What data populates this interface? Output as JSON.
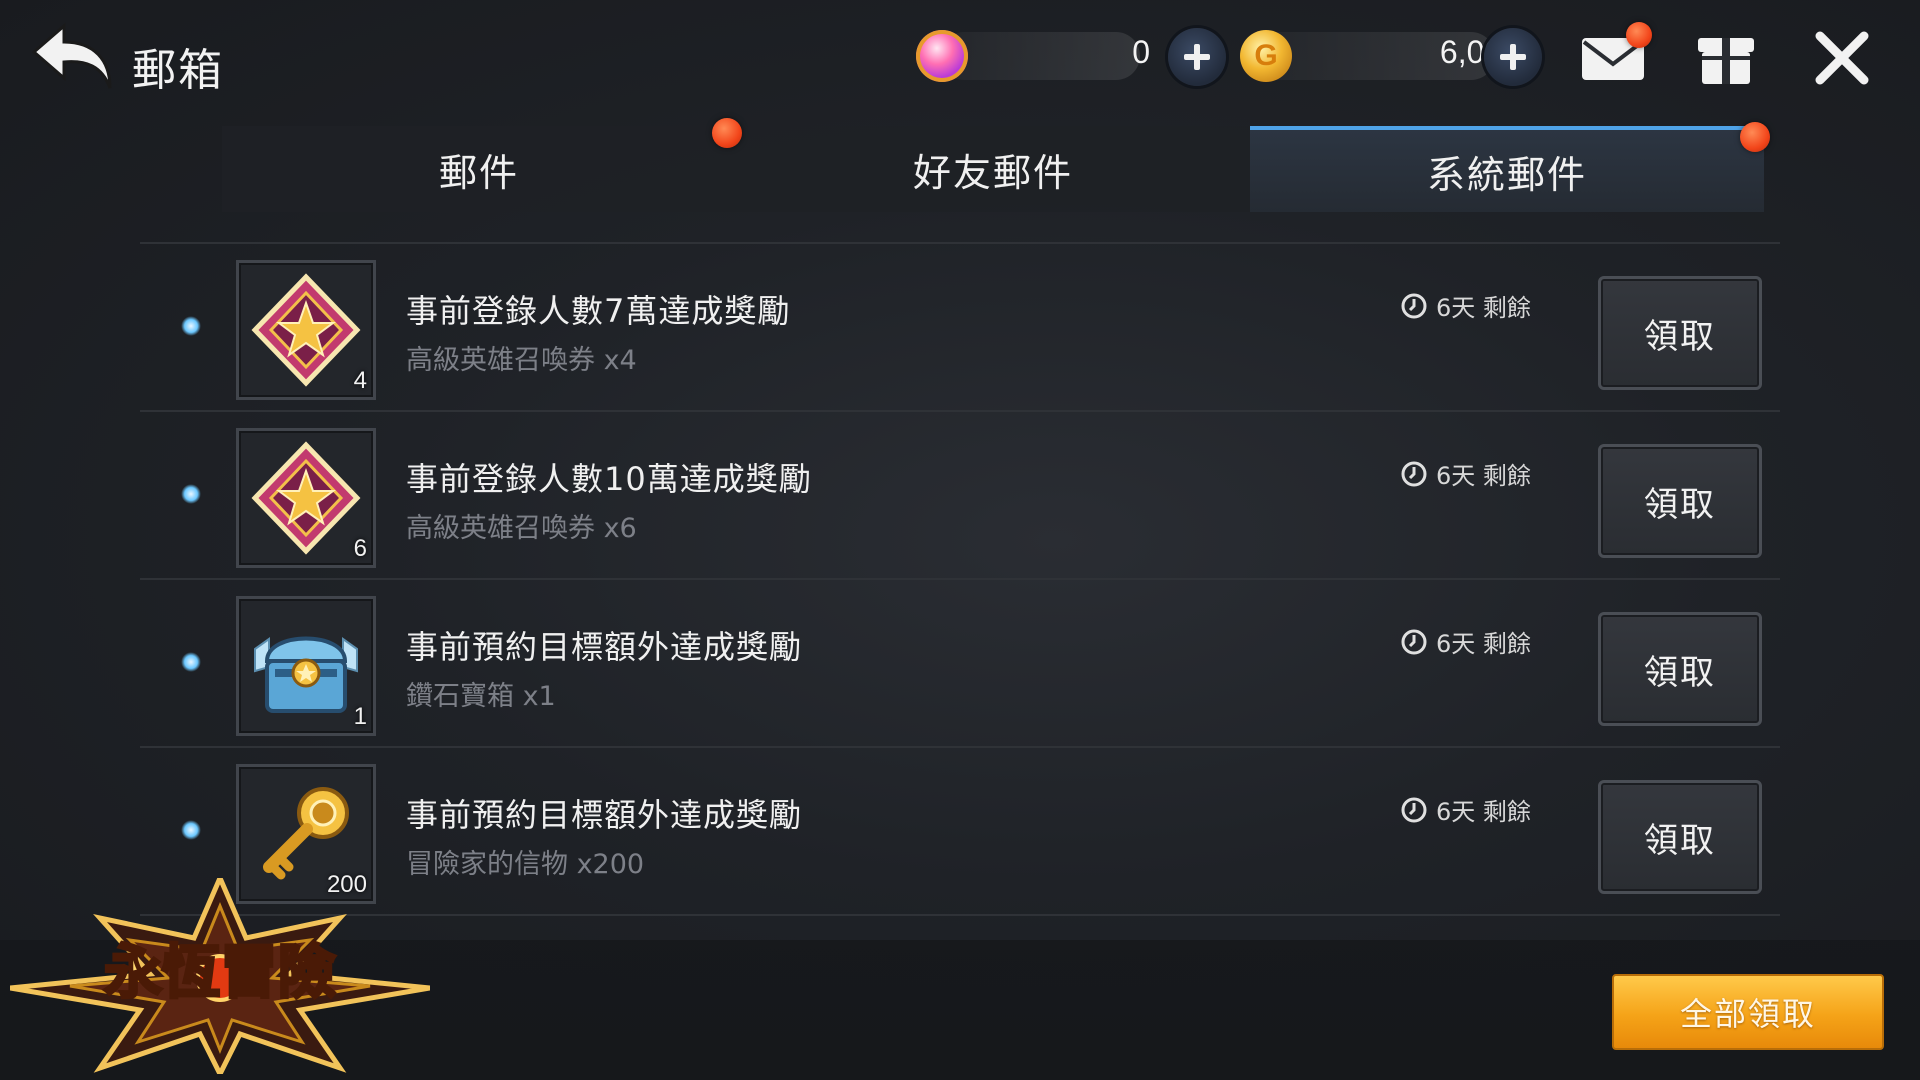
{
  "header": {
    "title": "郵箱",
    "gem_value": "0",
    "gold_value": "6,000"
  },
  "tabs": [
    {
      "label": "郵件",
      "active": false,
      "has_notice": true
    },
    {
      "label": "好友郵件",
      "active": false,
      "has_notice": false
    },
    {
      "label": "系統郵件",
      "active": true,
      "has_notice": true
    }
  ],
  "mails": [
    {
      "title": "事前登錄人數7萬達成獎勵",
      "reward": "高級英雄召喚券 x4",
      "count": "4",
      "remain": "6天 剩餘",
      "claim_label": "領取",
      "icon": "summon-ticket-icon"
    },
    {
      "title": "事前登錄人數10萬達成獎勵",
      "reward": "高級英雄召喚券 x6",
      "count": "6",
      "remain": "6天 剩餘",
      "claim_label": "領取",
      "icon": "summon-ticket-icon"
    },
    {
      "title": "事前預約目標額外達成獎勵",
      "reward": "鑽石寶箱 x1",
      "count": "1",
      "remain": "6天 剩餘",
      "claim_label": "領取",
      "icon": "diamond-chest-icon"
    },
    {
      "title": "事前預約目標額外達成獎勵",
      "reward": "冒險家的信物 x200",
      "count": "200",
      "remain": "6天 剩餘",
      "claim_label": "領取",
      "icon": "golden-key-icon"
    }
  ],
  "footer": {
    "claim_all_label": "全部領取",
    "logo_text": "永恆冒險"
  },
  "colors": {
    "accent_blue": "#4fa3e8",
    "notice_red": "#f2451a",
    "claim_all_orange": "#f5a318"
  }
}
